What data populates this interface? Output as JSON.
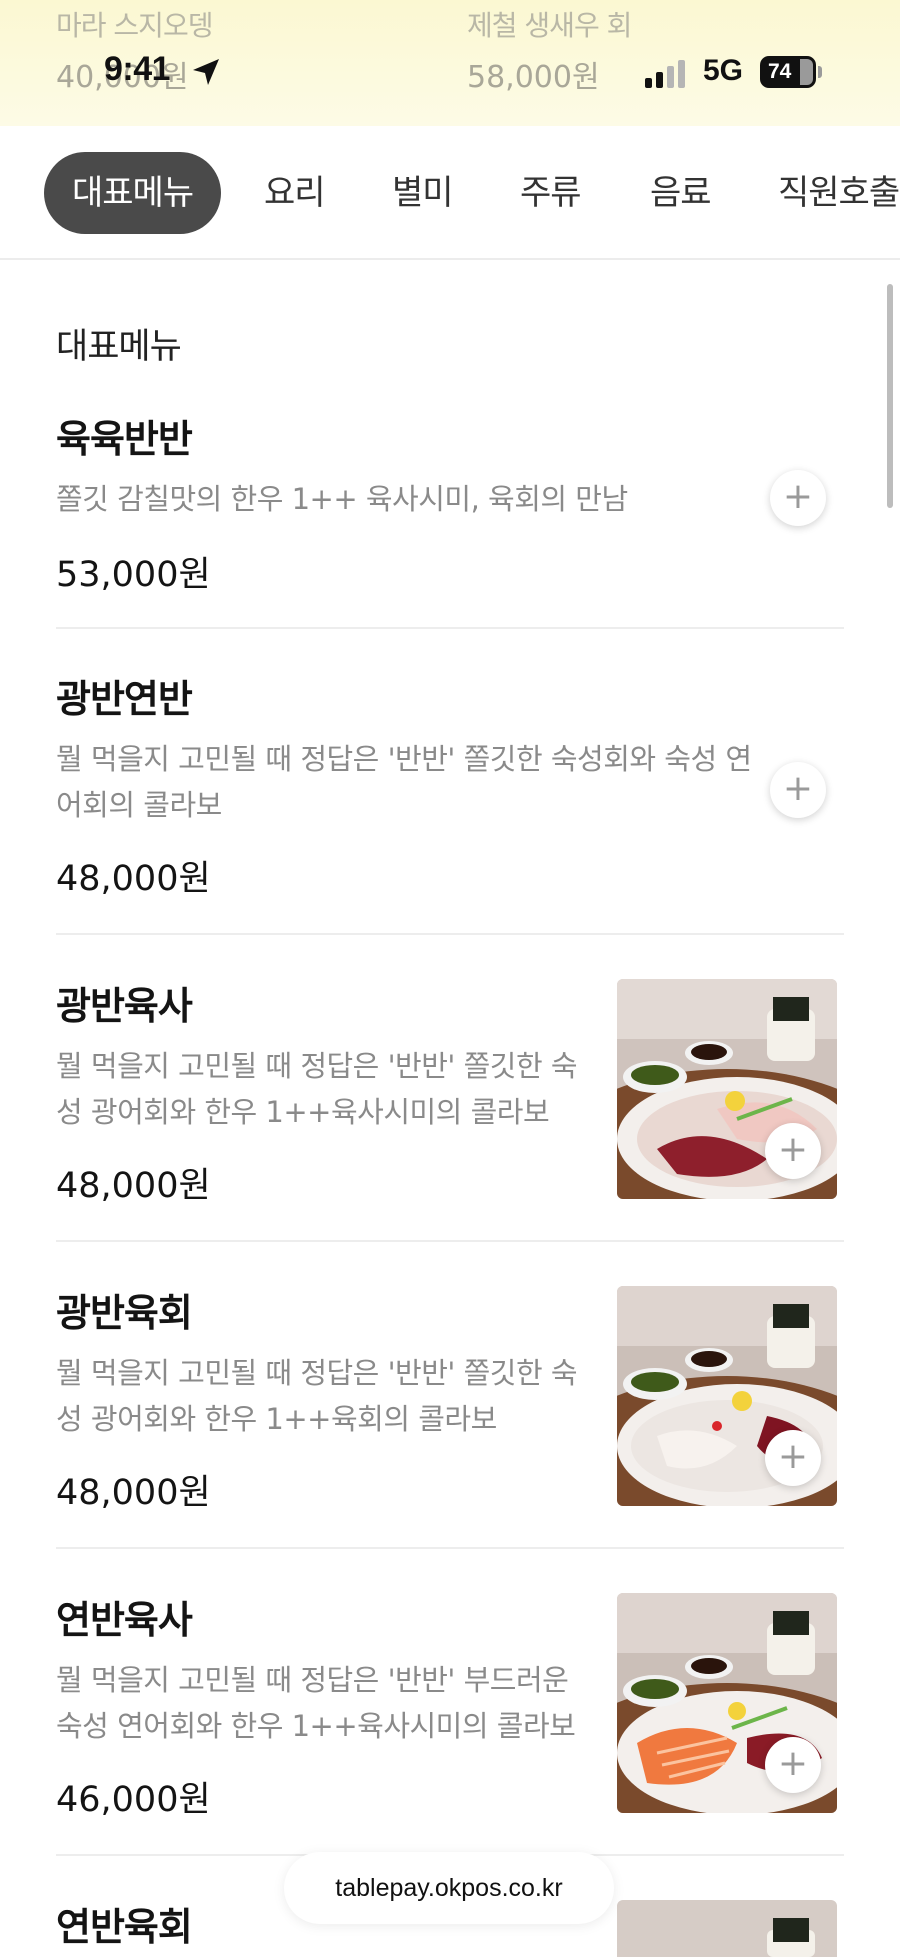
{
  "banner": {
    "items": [
      {
        "name": "마라 스지오뎅",
        "price": "40,000원"
      },
      {
        "name": "제철 생새우 회",
        "price": "58,000원"
      }
    ]
  },
  "status_bar": {
    "time": "9:41",
    "network": "5G",
    "battery": "74"
  },
  "tabs": [
    {
      "label": "대표메뉴",
      "active": true
    },
    {
      "label": "요리",
      "active": false
    },
    {
      "label": "별미",
      "active": false
    },
    {
      "label": "주류",
      "active": false
    },
    {
      "label": "음료",
      "active": false
    },
    {
      "label": "직원호출",
      "active": false
    }
  ],
  "section": {
    "title": "대표메뉴"
  },
  "menu_items": [
    {
      "name": "육육반반",
      "desc_lines": [
        "쫄깃 감칠맛의 한우 1++ 육사시미, 육회의 만남"
      ],
      "price": "53,000원",
      "has_image": false
    },
    {
      "name": "광반연반",
      "desc_lines": [
        "뭘 먹을지 고민될 때 정답은 '반반' 쫄깃한 숙성회와 숙성 연",
        "어회의 콜라보"
      ],
      "price": "48,000원",
      "has_image": false
    },
    {
      "name": "광반육사",
      "desc_lines": [
        "뭘 먹을지 고민될 때 정답은 '반반' 쫄깃한 숙",
        "성 광어회와 한우 1++육사시미의 콜라보"
      ],
      "price": "48,000원",
      "has_image": true
    },
    {
      "name": "광반육회",
      "desc_lines": [
        "뭘 먹을지 고민될 때 정답은 '반반' 쫄깃한 숙",
        "성 광어회와 한우 1++육회의 콜라보"
      ],
      "price": "48,000원",
      "has_image": true
    },
    {
      "name": "연반육사",
      "desc_lines": [
        "뭘 먹을지 고민될 때 정답은 '반반' 부드러운",
        "숙성 연어회와 한우 1++육사시미의 콜라보"
      ],
      "price": "46,000원",
      "has_image": true
    },
    {
      "name": "연반육회",
      "desc_lines": [],
      "price": "",
      "has_image": true
    }
  ],
  "add_button_symbol": "+",
  "url": "tablepay.okpos.co.kr"
}
